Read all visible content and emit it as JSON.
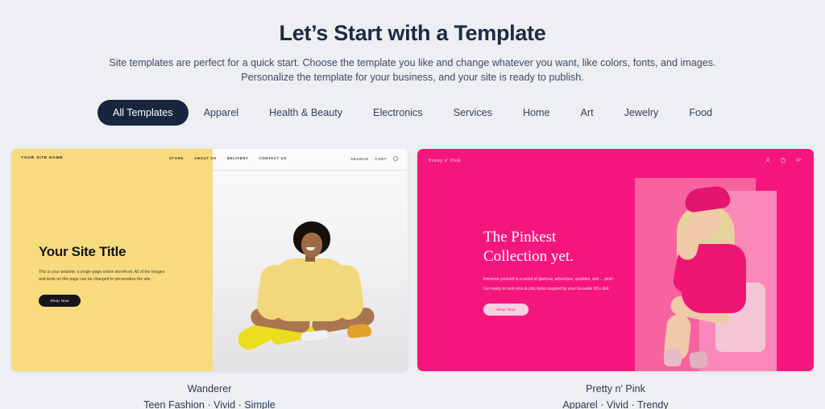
{
  "header": {
    "title": "Let’s Start with a Template",
    "subtitle_line1": "Site templates are perfect for a quick start. Choose the template you like and change whatever you want, like colors, fonts, and images.",
    "subtitle_line2": "Personalize the template for your business, and your site is ready to publish."
  },
  "filters": {
    "active": "All Templates",
    "tabs": [
      {
        "label": "All Templates",
        "active": true
      },
      {
        "label": "Apparel",
        "active": false
      },
      {
        "label": "Health & Beauty",
        "active": false
      },
      {
        "label": "Electronics",
        "active": false
      },
      {
        "label": "Services",
        "active": false
      },
      {
        "label": "Home",
        "active": false
      },
      {
        "label": "Art",
        "active": false
      },
      {
        "label": "Jewelry",
        "active": false
      },
      {
        "label": "Food",
        "active": false
      }
    ]
  },
  "templates": [
    {
      "name": "Wanderer",
      "tags": "Teen Fashion · Vivid · Simple",
      "accent": "#f8db7e",
      "preview": {
        "logo": "YOUR SITE NAME",
        "nav": [
          "STORE",
          "ABOUT US",
          "DELIVERY",
          "CONTACT US"
        ],
        "utility": [
          "SEARCH",
          "CART"
        ],
        "utility_icon": "account-circle-icon",
        "heading": "Your Site Title",
        "body": "This is your website, a single-page online storefront. All of the images and texts on this page can be changed to personalize the site.",
        "cta": "Shop Now"
      }
    },
    {
      "name": "Pretty n' Pink",
      "tags": "Apparel · Vivid · Trendy",
      "accent": "#f5167d",
      "preview": {
        "logo": "Pretty n' Pink",
        "icons": [
          "account-icon",
          "bag-icon",
          "menu-icon"
        ],
        "heading_line1": "The Pinkest",
        "heading_line2": "Collection yet.",
        "body_line1": "Immerse yourself in a world of glamour, adventure, sparkles, and ... pink!",
        "body_line2": "Get ready to rock retro & chic looks inspired by your favourite 90's doll.",
        "cta": "Shop Now"
      }
    }
  ],
  "colors": {
    "page_background": "#edeff2",
    "active_tab": "#17253f",
    "text": "#2c3a54",
    "yellow": "#f8db7e",
    "pink": "#f5167d"
  }
}
